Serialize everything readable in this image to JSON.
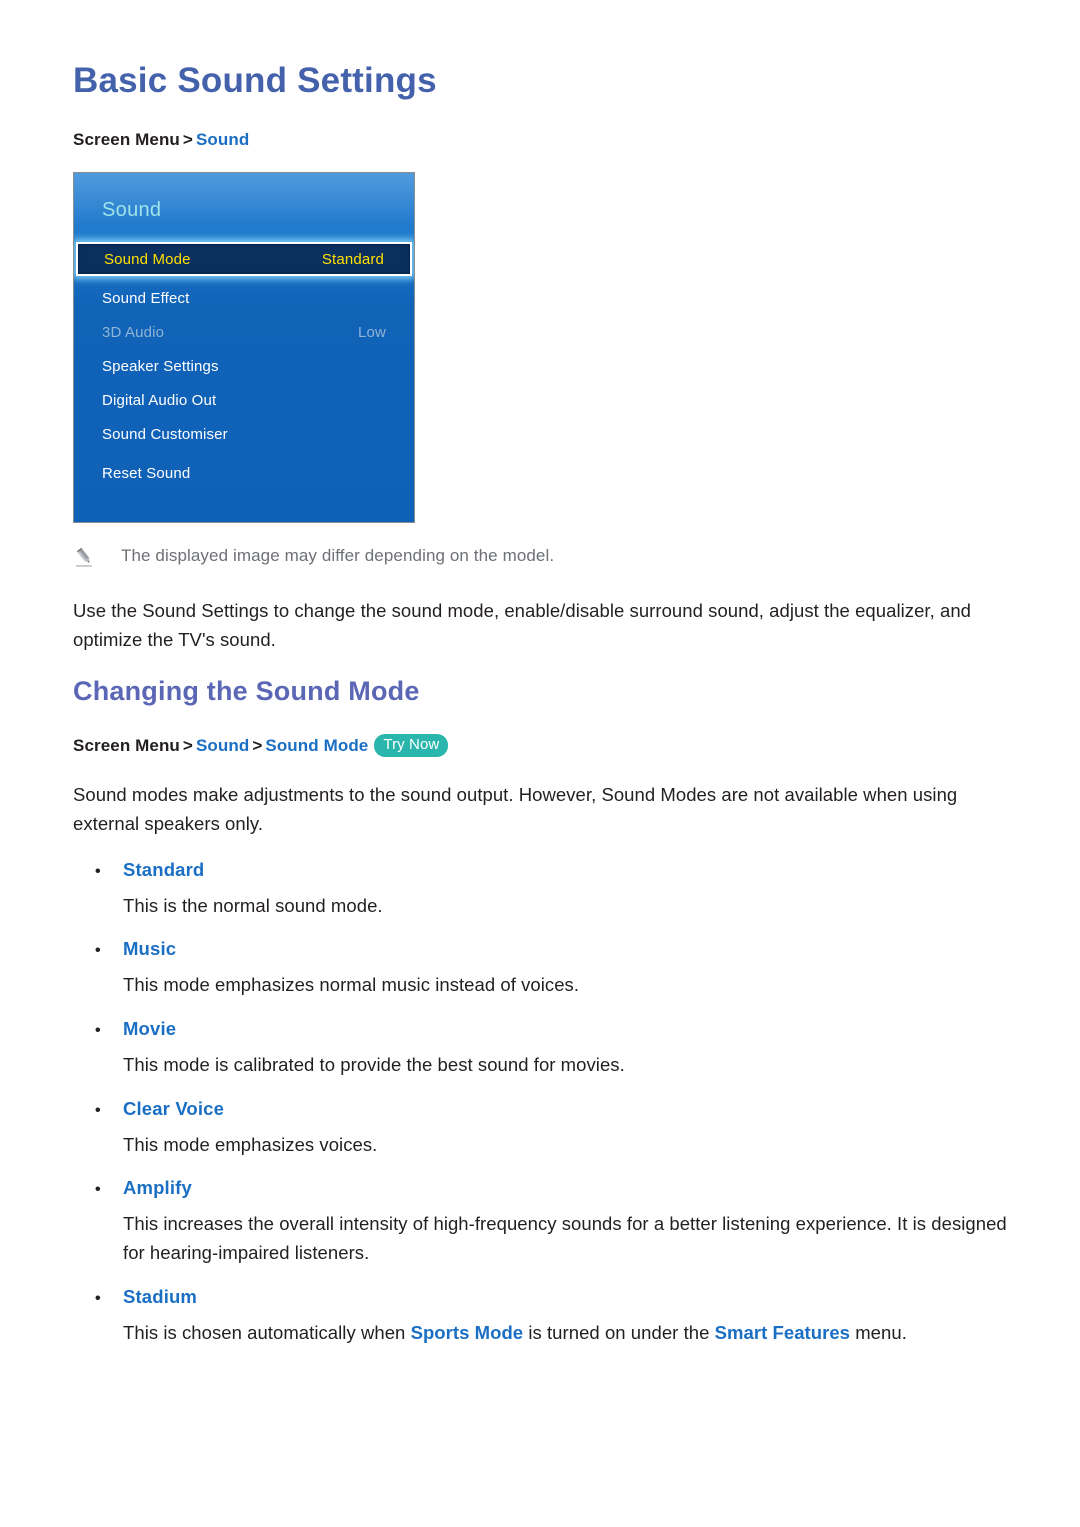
{
  "document": {
    "title": "Basic Sound Settings"
  },
  "breadcrumb_top": {
    "root": "Screen Menu",
    "separator": ">",
    "target": "Sound"
  },
  "tv_menu": {
    "header": "Sound",
    "rows": [
      {
        "label": "Sound Mode",
        "value": "Standard",
        "selected": true,
        "disabled": false
      },
      {
        "label": "Sound Effect",
        "value": "",
        "selected": false,
        "disabled": false
      },
      {
        "label": "3D Audio",
        "value": "Low",
        "selected": false,
        "disabled": true
      },
      {
        "label": "Speaker Settings",
        "value": "",
        "selected": false,
        "disabled": false
      },
      {
        "label": "Digital Audio Out",
        "value": "",
        "selected": false,
        "disabled": false
      },
      {
        "label": "Sound Customiser",
        "value": "",
        "selected": false,
        "disabled": false
      },
      {
        "label": "Reset Sound",
        "value": "",
        "selected": false,
        "disabled": false
      }
    ],
    "colors": {
      "panel_top": "#2e7fd0",
      "panel_bottom": "#0f61b7",
      "header_text": "#9de3e8",
      "selected_bg": "#0b2f5e",
      "selected_text": "#ffe000",
      "disabled_text": "#8fb4d6"
    }
  },
  "note": {
    "icon": "pencil-icon",
    "text": "The displayed image may differ depending on the model."
  },
  "intro_paragraph": "Use the Sound Settings to change the sound mode, enable/disable surround sound, adjust the equalizer, and optimize the TV's sound.",
  "section": {
    "title": "Changing the Sound Mode",
    "breadcrumb": {
      "root": "Screen Menu",
      "separator": ">",
      "crumb_1": "Sound",
      "crumb_2": "Sound Mode",
      "badge": "Try Now",
      "badge_color": "#2bb6ad"
    },
    "paragraph": "Sound modes make adjustments to the sound output. However, Sound Modes are not available when using external speakers only.",
    "bullets": [
      {
        "label": "Standard",
        "description": "This is the normal sound mode."
      },
      {
        "label": "Music",
        "description": "This mode emphasizes normal music instead of voices."
      },
      {
        "label": "Movie",
        "description": "This mode is calibrated to provide the best sound for movies."
      },
      {
        "label": "Clear Voice",
        "description": "This mode emphasizes voices."
      },
      {
        "label": "Amplify",
        "description": "This increases the overall intensity of high-frequency sounds for a better listening experience. It is designed for hearing-impaired listeners."
      },
      {
        "label": "Stadium",
        "description_part_1": "This is chosen automatically when ",
        "link_1": "Sports Mode",
        "description_part_2": " is turned on under the ",
        "link_2": "Smart Features",
        "description_part_3": " menu."
      }
    ]
  },
  "theme": {
    "title_color": "#4461ab",
    "section_title_color": "#5b67b5",
    "link_color": "#1a6fc4",
    "body_color": "#231f20",
    "note_color": "#6d7076"
  }
}
